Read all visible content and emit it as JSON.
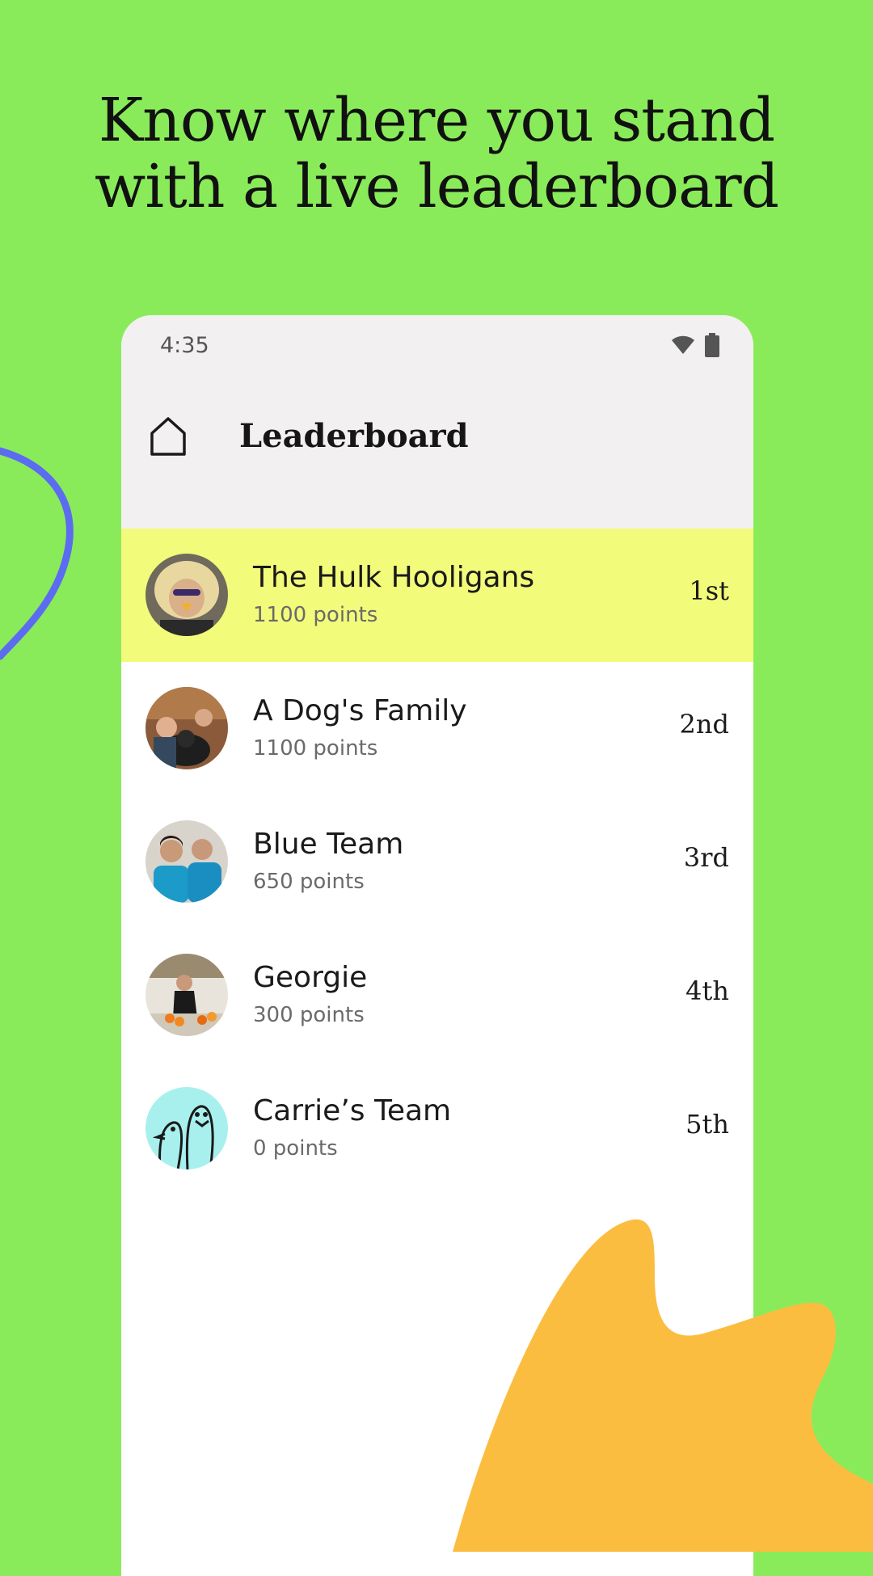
{
  "headline": {
    "line1": "Know where you stand",
    "line2": "with a live leaderboard"
  },
  "colors": {
    "background": "#8aeb5a",
    "highlight_row": "#f2fb7a",
    "accent_blob": "#fbbd40",
    "accent_arc": "#5b6cf0"
  },
  "status_bar": {
    "time": "4:35",
    "icons": [
      "wifi-icon",
      "battery-icon"
    ]
  },
  "app_bar": {
    "home_icon": "home-icon",
    "title": "Leaderboard"
  },
  "leaderboard": [
    {
      "name": "The Hulk Hooligans",
      "points": "1100 points",
      "rank": "1st",
      "highlighted": true
    },
    {
      "name": "A Dog's Family",
      "points": "1100 points",
      "rank": "2nd",
      "highlighted": false
    },
    {
      "name": "Blue Team",
      "points": "650 points",
      "rank": "3rd",
      "highlighted": false
    },
    {
      "name": "Georgie",
      "points": "300 points",
      "rank": "4th",
      "highlighted": false
    },
    {
      "name": "Carrie’s Team",
      "points": "0 points",
      "rank": "5th",
      "highlighted": false
    }
  ]
}
